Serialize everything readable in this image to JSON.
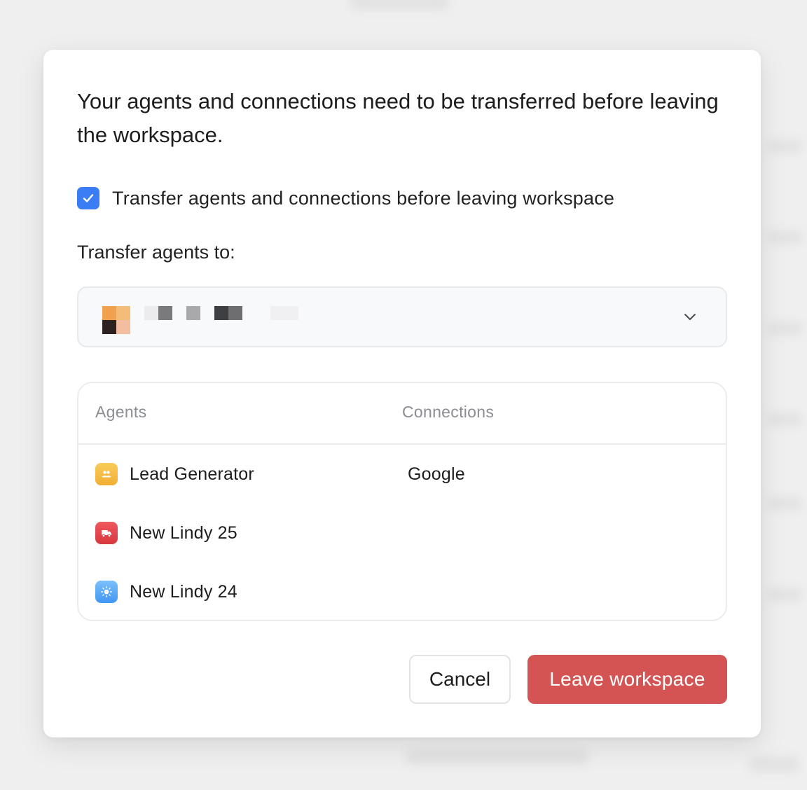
{
  "dialog": {
    "heading": "Your agents and connections need to be transferred before leaving the workspace.",
    "transfer_checkbox": {
      "label": "Transfer agents and connections before leaving workspace",
      "checked": true
    },
    "transfer_to_label": "Transfer agents to:",
    "select": {
      "selected_value": "",
      "icon": "chevron-down-icon"
    },
    "table": {
      "headers": {
        "agents": "Agents",
        "connections": "Connections"
      },
      "rows": [
        {
          "agent": "Lead Generator",
          "icon": "people-icon",
          "icon_color": "#f5b63b",
          "connection": "Google"
        },
        {
          "agent": "New Lindy 25",
          "icon": "truck-icon",
          "icon_color": "#e0464b",
          "connection": ""
        },
        {
          "agent": "New Lindy 24",
          "icon": "sun-icon",
          "icon_color": "#4aa3f5",
          "connection": ""
        }
      ]
    },
    "buttons": {
      "cancel": "Cancel",
      "leave": "Leave workspace"
    }
  },
  "colors": {
    "accent": "#3b7df5",
    "danger": "#d45454",
    "background": "#efefef"
  }
}
